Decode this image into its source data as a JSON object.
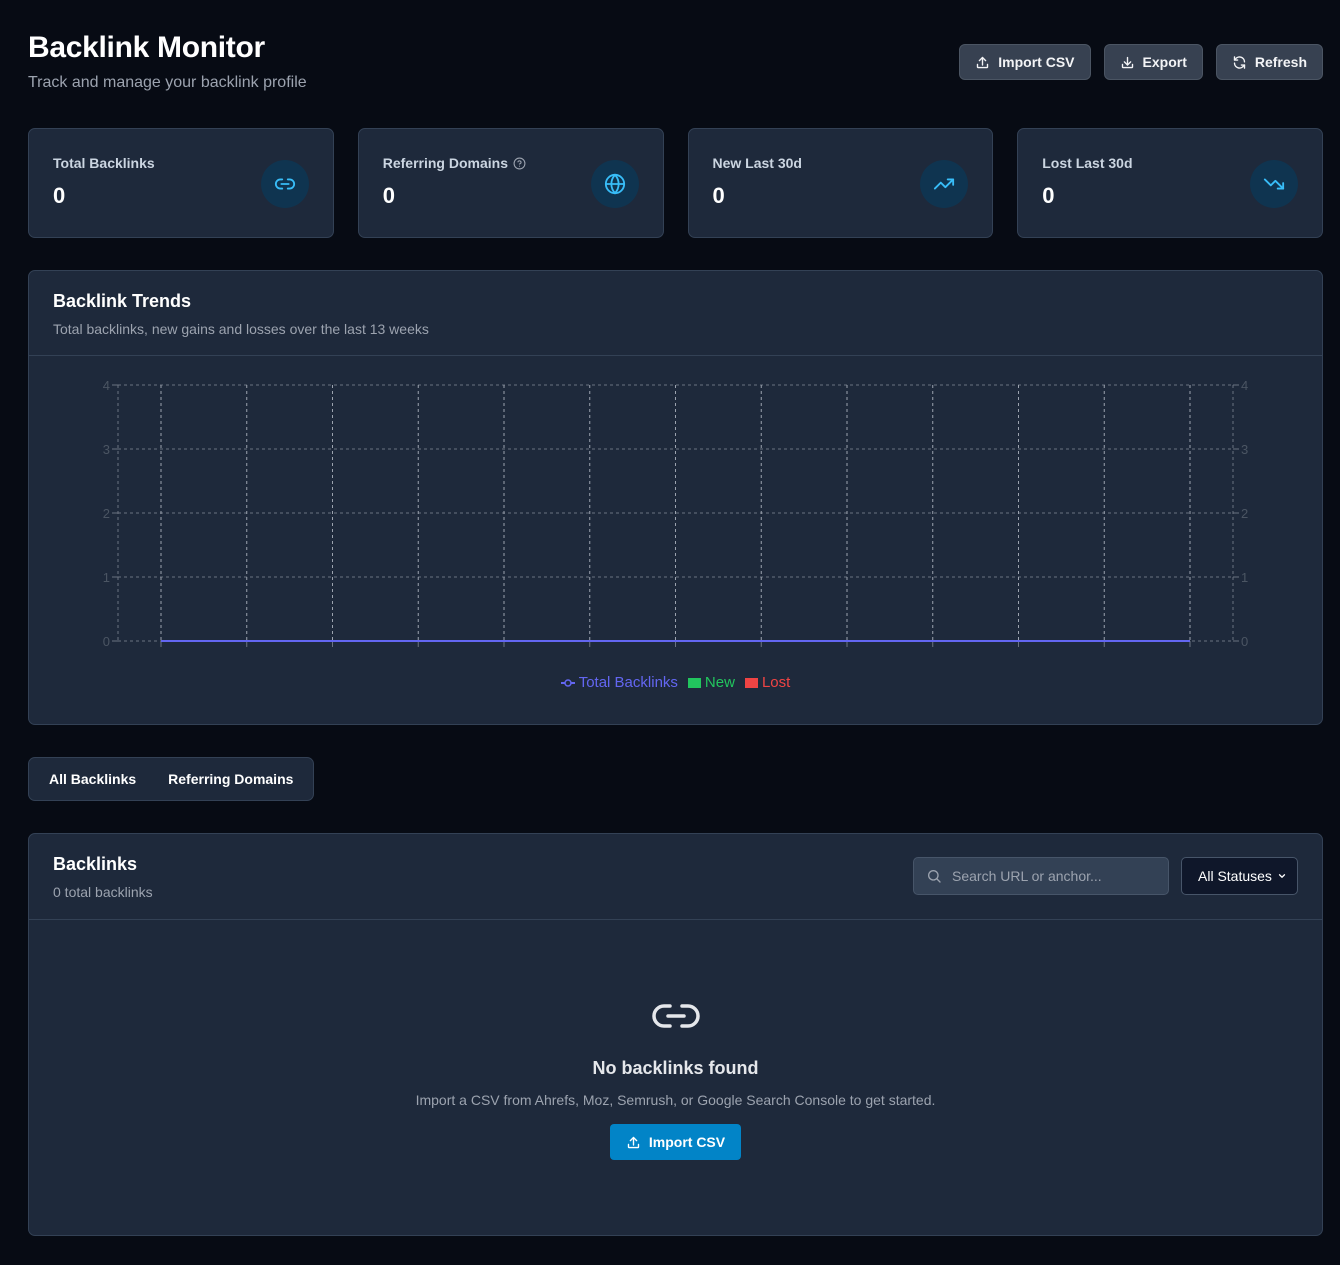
{
  "header": {
    "title": "Backlink Monitor",
    "subtitle": "Track and manage your backlink profile",
    "import_label": "Import CSV",
    "export_label": "Export",
    "refresh_label": "Refresh"
  },
  "stats": [
    {
      "label": "Total Backlinks",
      "value": "0",
      "icon": "link-icon"
    },
    {
      "label": "Referring Domains",
      "value": "0",
      "icon": "globe-icon",
      "help": "help-circle-icon"
    },
    {
      "label": "New Last 30d",
      "value": "0",
      "icon": "trending-up-icon"
    },
    {
      "label": "Lost Last 30d",
      "value": "0",
      "icon": "trending-down-icon"
    }
  ],
  "trends": {
    "title": "Backlink Trends",
    "description": "Total backlinks, new gains and losses over the last 13 weeks"
  },
  "chart_data": {
    "type": "line",
    "categories": [
      "",
      "",
      "",
      "",
      "",
      "",
      "",
      "",
      "",
      "",
      "",
      "",
      ""
    ],
    "series": [
      {
        "name": "Total Backlinks",
        "type": "line",
        "color": "#6366f1",
        "values": [
          0,
          0,
          0,
          0,
          0,
          0,
          0,
          0,
          0,
          0,
          0,
          0,
          0
        ]
      },
      {
        "name": "New",
        "type": "bar",
        "color": "#22c55e",
        "values": [
          0,
          0,
          0,
          0,
          0,
          0,
          0,
          0,
          0,
          0,
          0,
          0,
          0
        ]
      },
      {
        "name": "Lost",
        "type": "bar",
        "color": "#ef4444",
        "values": [
          0,
          0,
          0,
          0,
          0,
          0,
          0,
          0,
          0,
          0,
          0,
          0,
          0
        ]
      }
    ],
    "y_ticks": [
      "0",
      "1",
      "2",
      "3",
      "4"
    ],
    "ylim": [
      0,
      4
    ],
    "y2_ticks": [
      "0",
      "1",
      "2",
      "3",
      "4"
    ],
    "grid": true,
    "legend": "bottom"
  },
  "tabs": [
    "All Backlinks",
    "Referring Domains"
  ],
  "backlinks": {
    "title": "Backlinks",
    "count_text": "0 total backlinks",
    "search_placeholder": "Search URL or anchor...",
    "status_filter": "All Statuses",
    "empty_title": "No backlinks found",
    "empty_desc": "Import a CSV from Ahrefs, Moz, Semrush, or Google Search Console to get started.",
    "empty_button": "Import CSV"
  },
  "colors": {
    "background": "#070b14",
    "card": "#1e293b",
    "accent": "#0284c7",
    "icon_accent": "#38bdf8"
  }
}
